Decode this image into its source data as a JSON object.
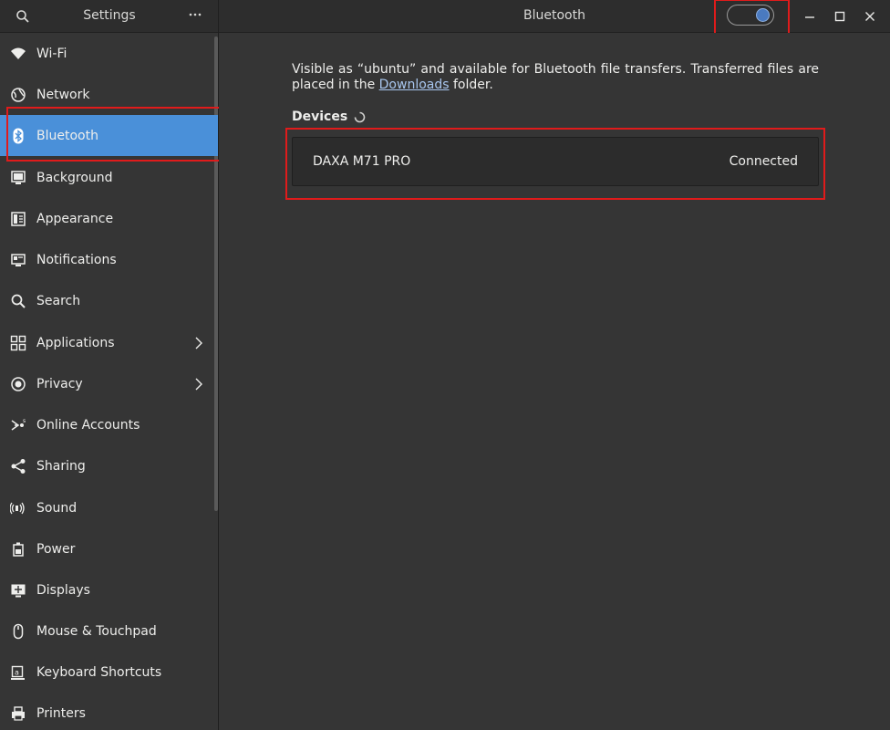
{
  "sidebar": {
    "title": "Settings",
    "items": [
      {
        "label": "Wi-Fi",
        "icon": "wifi-icon"
      },
      {
        "label": "Network",
        "icon": "network-icon"
      },
      {
        "label": "Bluetooth",
        "icon": "bluetooth-icon",
        "selected": true
      },
      {
        "label": "Background",
        "icon": "background-icon"
      },
      {
        "label": "Appearance",
        "icon": "appearance-icon"
      },
      {
        "label": "Notifications",
        "icon": "notifications-icon"
      },
      {
        "label": "Search",
        "icon": "search-icon"
      },
      {
        "label": "Applications",
        "icon": "applications-icon",
        "has_submenu": true
      },
      {
        "label": "Privacy",
        "icon": "privacy-icon",
        "has_submenu": true
      },
      {
        "label": "Online Accounts",
        "icon": "online-accounts-icon"
      },
      {
        "label": "Sharing",
        "icon": "sharing-icon"
      },
      {
        "label": "Sound",
        "icon": "sound-icon"
      },
      {
        "label": "Power",
        "icon": "power-icon"
      },
      {
        "label": "Displays",
        "icon": "displays-icon"
      },
      {
        "label": "Mouse & Touchpad",
        "icon": "mouse-icon"
      },
      {
        "label": "Keyboard Shortcuts",
        "icon": "keyboard-icon"
      },
      {
        "label": "Printers",
        "icon": "printer-icon"
      }
    ]
  },
  "header": {
    "title": "Bluetooth",
    "bluetooth_enabled": true
  },
  "main": {
    "description_before": "Visible as “ubuntu” and available for Bluetooth file transfers. Transferred files are placed in the ",
    "description_link": "Downloads",
    "description_after": " folder.",
    "devices_heading": "Devices",
    "devices": [
      {
        "name": "DAXA M71 PRO",
        "status": "Connected"
      }
    ]
  },
  "colors": {
    "accent": "#4a90d9",
    "highlight": "#e01b1b",
    "background": "#353535",
    "header": "#2d2d2d"
  }
}
